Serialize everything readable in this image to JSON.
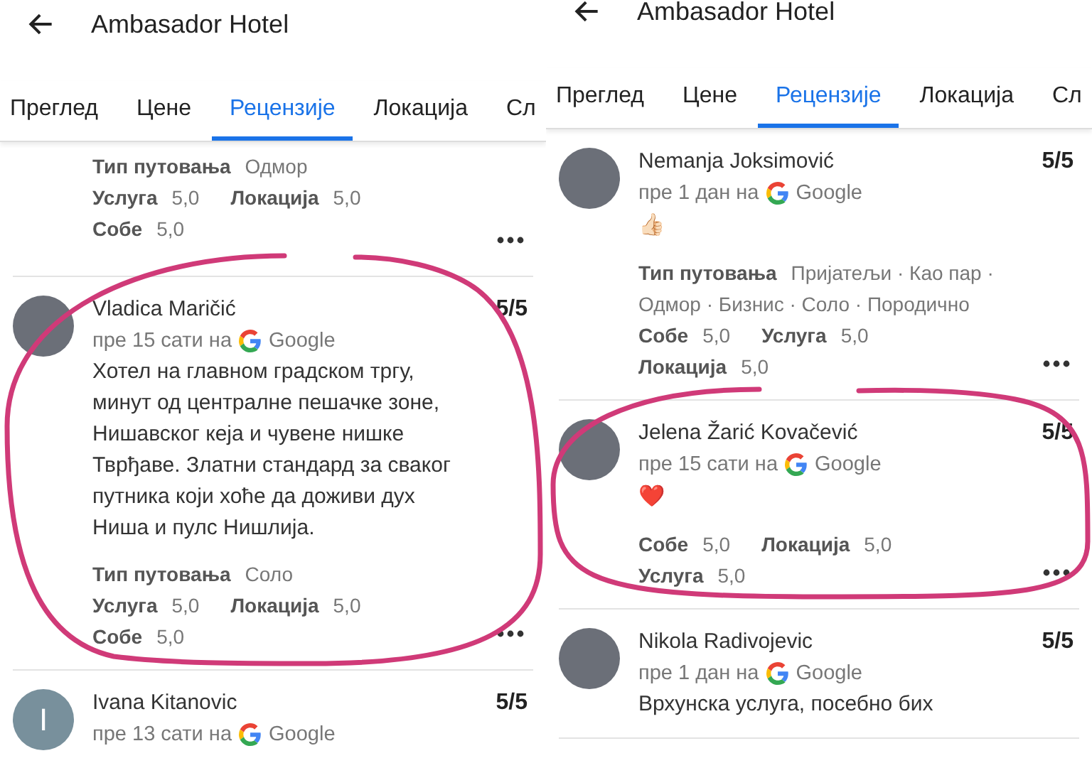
{
  "panels": [
    {
      "title": "Ambasador Hotel",
      "tabs": [
        {
          "label": "Преглед",
          "selected": false
        },
        {
          "label": "Цене",
          "selected": false
        },
        {
          "label": "Рецензије",
          "selected": true
        },
        {
          "label": "Локација",
          "selected": false
        },
        {
          "label": "Сл",
          "selected": false
        }
      ],
      "reviews": [
        {
          "kind": "partial",
          "attributes": [
            [
              {
                "label": "Тип путовања",
                "value": "Одмор"
              }
            ],
            [
              {
                "label": "Услуга",
                "value": "5,0"
              },
              {
                "label": "Локација",
                "value": "5,0"
              }
            ],
            [
              {
                "label": "Собе",
                "value": "5,0"
              }
            ]
          ]
        },
        {
          "kind": "full",
          "author": "Vladica Maričić",
          "time": "пре 15 сати на",
          "source": "Google",
          "rating": "5/5",
          "text": "Хотел на главном градском тргу, минут од централне пешачке зоне, Нишавског кеја и чувене нишке Тврђаве. Златни стандард за сваког путника који хоће да доживи дух Ниша и пулс Нишлија.",
          "attributes": [
            [
              {
                "label": "Тип путовања",
                "value": "Соло"
              }
            ],
            [
              {
                "label": "Услуга",
                "value": "5,0"
              },
              {
                "label": "Локација",
                "value": "5,0"
              }
            ],
            [
              {
                "label": "Собе",
                "value": "5,0"
              }
            ]
          ]
        },
        {
          "kind": "full",
          "initial": "I",
          "author": "Ivana Kitanovic",
          "time": "пре 13 сати на",
          "source": "Google",
          "rating": "5/5"
        }
      ]
    },
    {
      "title": "Ambasador Hotel",
      "tabs": [
        {
          "label": "Преглед",
          "selected": false
        },
        {
          "label": "Цене",
          "selected": false
        },
        {
          "label": "Рецензије",
          "selected": true
        },
        {
          "label": "Локација",
          "selected": false
        },
        {
          "label": "Сл",
          "selected": false
        }
      ],
      "reviews": [
        {
          "kind": "full",
          "author": "Nemanja Joksimović",
          "time": "пре 1 дан на",
          "source": "Google",
          "rating": "5/5",
          "emoji": "👍🏻",
          "attributes": [
            [
              {
                "label": "Тип путовања",
                "value": "Пријатељи · Као пар ·"
              }
            ],
            [
              {
                "value": "Одмор · Бизнис · Соло · Породично"
              }
            ],
            [
              {
                "label": "Собе",
                "value": "5,0"
              },
              {
                "label": "Услуга",
                "value": "5,0"
              }
            ],
            [
              {
                "label": "Локација",
                "value": "5,0"
              }
            ]
          ]
        },
        {
          "kind": "full",
          "author": "Jelena Žarić Kovačević",
          "time": "пре 15 сати на",
          "source": "Google",
          "rating": "5/5",
          "emoji": "❤️",
          "attributes": [
            [
              {
                "label": "Собе",
                "value": "5,0"
              },
              {
                "label": "Локација",
                "value": "5,0"
              }
            ],
            [
              {
                "label": "Услуга",
                "value": "5,0"
              }
            ]
          ]
        },
        {
          "kind": "full",
          "author": "Nikola Radivojevic",
          "time": "пре 1 дан на",
          "source": "Google",
          "rating": "5/5",
          "text": "Врхунска услуга, посебно бих"
        }
      ]
    }
  ]
}
